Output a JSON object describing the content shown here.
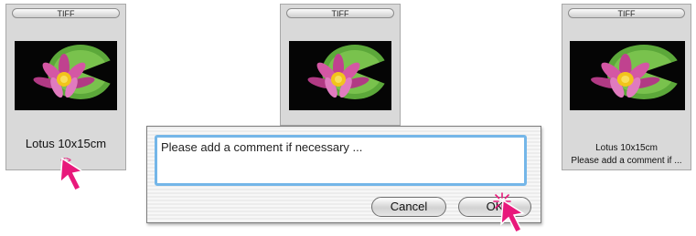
{
  "cards": [
    {
      "tab_label": "TIFF",
      "caption": "Lotus 10x15cm",
      "toggle_label": "<>"
    },
    {
      "tab_label": "TIFF"
    },
    {
      "tab_label": "TIFF",
      "caption": "Lotus 10x15cm",
      "comment": "Please add a comment if ..."
    }
  ],
  "dialog": {
    "comment_value": "Please add a comment if necessary ...",
    "cancel_label": "Cancel",
    "ok_label": "OK"
  },
  "colors": {
    "cursor": "#e8197b",
    "field_focus": "#74b6e8"
  },
  "icons": [
    "pointer-cursor-icon",
    "click-burst-icon"
  ]
}
